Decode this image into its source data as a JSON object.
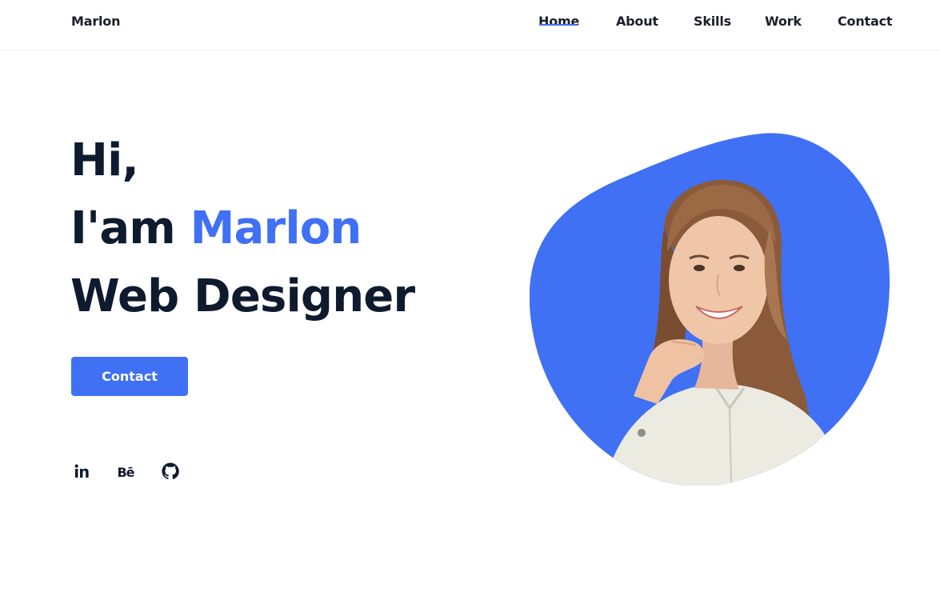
{
  "nav": {
    "brand": "Marlon",
    "items": [
      {
        "label": "Home",
        "active": true
      },
      {
        "label": "About",
        "active": false
      },
      {
        "label": "Skills",
        "active": false
      },
      {
        "label": "Work",
        "active": false
      },
      {
        "label": "Contact",
        "active": false
      }
    ]
  },
  "hero": {
    "greeting": "Hi,",
    "intro": "I'am",
    "name": "Marlon",
    "role": "Web Designer",
    "cta_label": "Contact"
  },
  "social": [
    {
      "icon": "linkedin-icon",
      "glyph": "in"
    },
    {
      "icon": "behance-icon",
      "glyph": "Bē"
    },
    {
      "icon": "github-icon",
      "glyph": ""
    }
  ],
  "image": {
    "subject": "smiling-woman-portrait"
  },
  "colors": {
    "accent": "#4070f4",
    "text": "#0e1b2e",
    "background": "#ffffff"
  }
}
